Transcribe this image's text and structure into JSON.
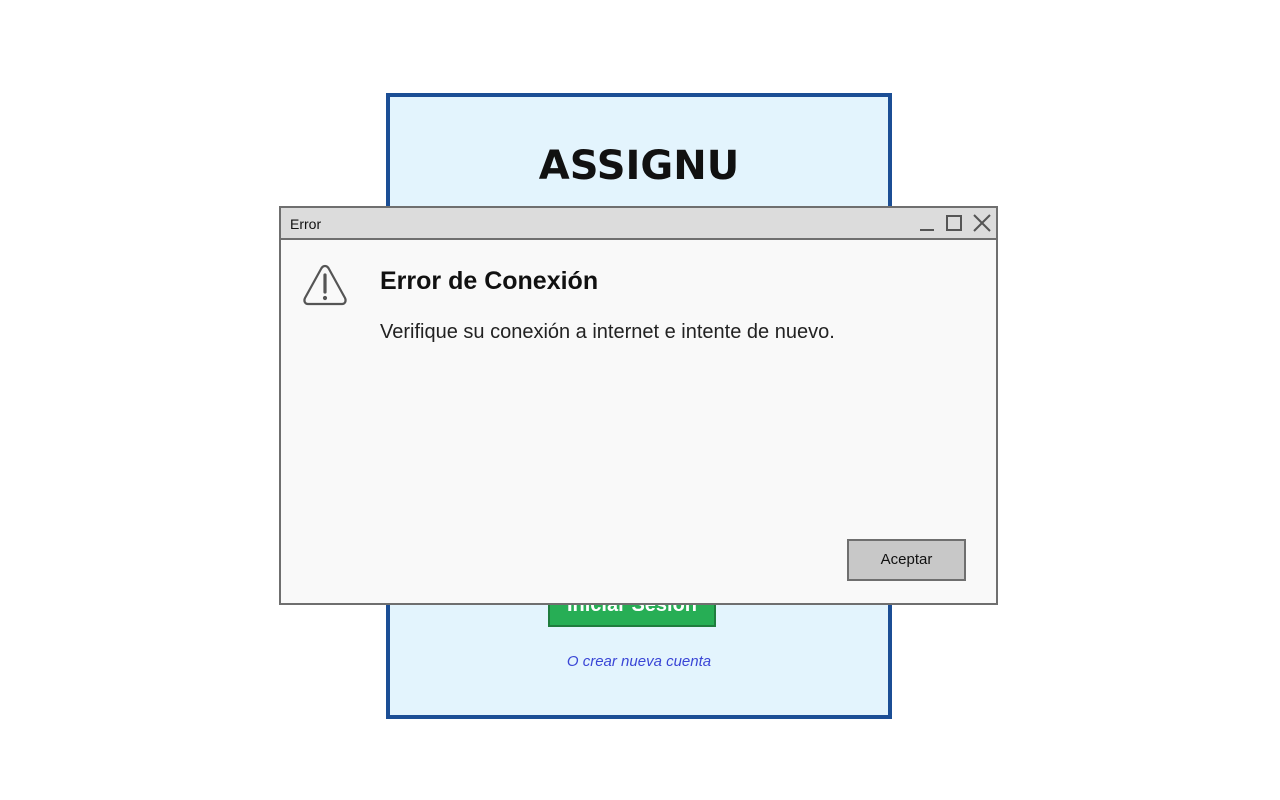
{
  "login": {
    "app_title": "ASSIGNU",
    "login_button_label": "Iniciar Sesión",
    "create_account_link": "O crear nueva cuenta"
  },
  "dialog": {
    "window_title": "Error",
    "heading": "Error de Conexión",
    "message": "Verifique su conexión a internet e intente de nuevo.",
    "accept_label": "Aceptar",
    "icons": {
      "warning": "warning-icon",
      "minimize": "minimize-icon",
      "maximize": "maximize-icon",
      "close": "close-icon"
    }
  },
  "colors": {
    "card_background": "#e3f4fd",
    "card_border": "#1b4e95",
    "primary_button": "#27ae55",
    "link": "#3a46d6",
    "dialog_background": "#f9f9f9",
    "titlebar_background": "#dcdcdc"
  }
}
